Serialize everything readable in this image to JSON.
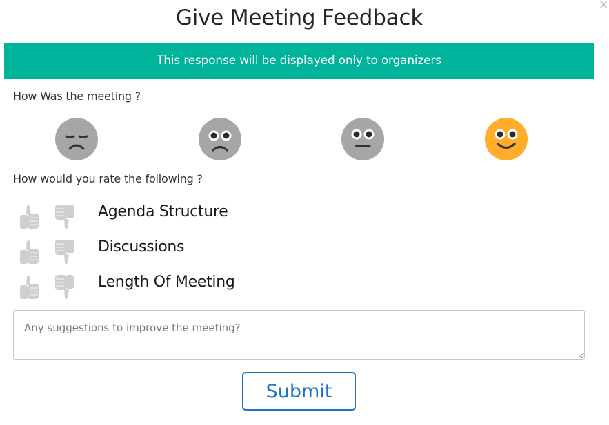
{
  "dialog": {
    "title": "Give Meeting Feedback",
    "close_label": "×",
    "banner": "This response will be displayed only to organizers"
  },
  "colors": {
    "banner_bg": "#00b49b",
    "emoji_inactive": "#a6a6a6",
    "emoji_selected": "#ffad2a",
    "thumb": "#cfcfcf",
    "submit_accent": "#1f74c4"
  },
  "meeting_question": {
    "label": "How Was the meeting ?",
    "options": [
      {
        "name": "very-unhappy",
        "icon": "sad-face-icon",
        "selected": false
      },
      {
        "name": "unhappy",
        "icon": "frown-face-icon",
        "selected": false
      },
      {
        "name": "neutral",
        "icon": "neutral-face-icon",
        "selected": false
      },
      {
        "name": "happy",
        "icon": "smile-face-icon",
        "selected": true
      }
    ]
  },
  "rating_question": {
    "label": "How would you rate the following ?",
    "items": [
      {
        "label": "Agenda Structure",
        "up_icon": "thumbs-up-icon",
        "down_icon": "thumbs-down-icon"
      },
      {
        "label": "Discussions",
        "up_icon": "thumbs-up-icon",
        "down_icon": "thumbs-down-icon"
      },
      {
        "label": "Length Of Meeting",
        "up_icon": "thumbs-up-icon",
        "down_icon": "thumbs-down-icon"
      }
    ]
  },
  "suggestions": {
    "placeholder": "Any suggestions to improve the meeting?",
    "value": ""
  },
  "submit": {
    "label": "Submit"
  }
}
